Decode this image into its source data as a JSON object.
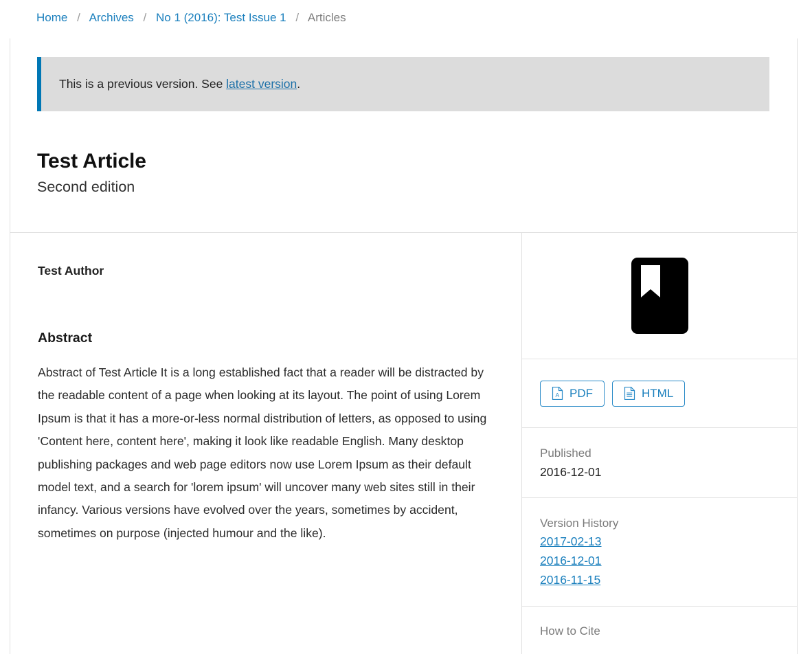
{
  "breadcrumb": {
    "separator": "/",
    "items": [
      {
        "label": "Home",
        "type": "link"
      },
      {
        "label": "Archives",
        "type": "link"
      },
      {
        "label": "No 1 (2016): Test Issue 1",
        "type": "link"
      },
      {
        "label": "Articles",
        "type": "current"
      }
    ]
  },
  "notice": {
    "text_before": "This is a previous version. See ",
    "link_label": "latest version",
    "text_after": ".",
    "accent_color": "#0077b5",
    "background_color": "#dcdcdc"
  },
  "article": {
    "title": "Test Article",
    "subtitle": "Second edition",
    "author": "Test Author",
    "abstract_heading": "Abstract",
    "abstract": "Abstract of Test Article It is a long established fact that a reader will be distracted by the readable content of a page when looking at its layout. The point of using Lorem Ipsum is that it has a more-or-less normal distribution of letters, as opposed to using 'Content here, content here', making it look like readable English. Many desktop publishing packages and web page editors now use Lorem Ipsum as their default model text, and a search for 'lorem ipsum' will uncover many web sites still in their infancy. Various versions have evolved over the years, sometimes by accident, sometimes on purpose (injected humour and the like)."
  },
  "sidebar": {
    "cover_icon": "book-cover-icon",
    "galleys": [
      {
        "label": "PDF",
        "icon": "pdf-file-icon"
      },
      {
        "label": "HTML",
        "icon": "html-file-icon"
      }
    ],
    "published": {
      "label": "Published",
      "value": "2016-12-01"
    },
    "version_history": {
      "label": "Version History",
      "versions": [
        {
          "label": "2017-02-13"
        },
        {
          "label": "2016-12-01"
        },
        {
          "label": "2016-11-15"
        }
      ]
    },
    "how_to_cite": {
      "label": "How to Cite"
    }
  },
  "theme": {
    "link_color": "#1a7fbd",
    "border_color": "#e0e0e0",
    "muted_text_color": "#7b7b7b"
  }
}
